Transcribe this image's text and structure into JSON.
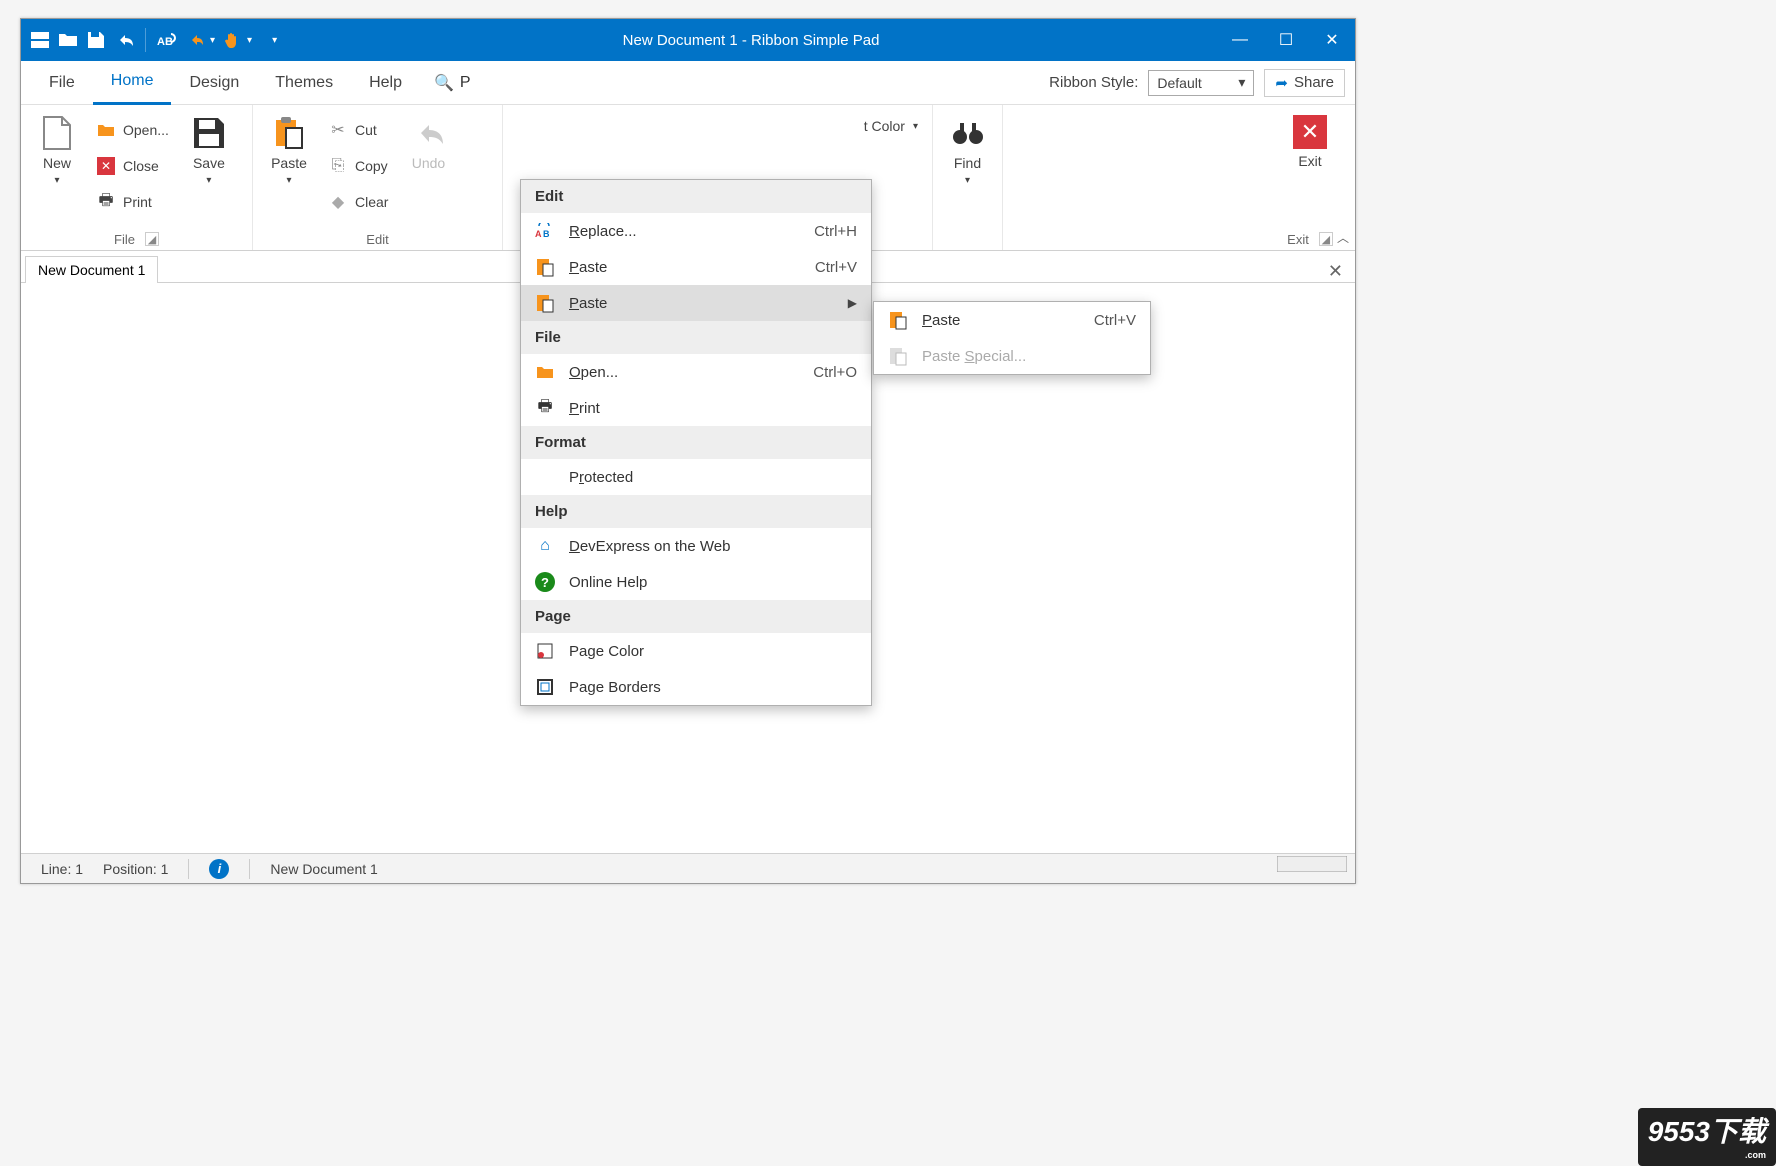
{
  "window": {
    "title": "New Document 1 - Ribbon Simple Pad"
  },
  "tabs": {
    "file": "File",
    "home": "Home",
    "design": "Design",
    "themes": "Themes",
    "help": "Help"
  },
  "search": "P",
  "ribbonStyle": {
    "label": "Ribbon Style:",
    "value": "Default"
  },
  "share": "Share",
  "ribbon": {
    "file": {
      "new": "New",
      "open": "Open...",
      "close": "Close",
      "print": "Print",
      "save": "Save",
      "groupLabel": "File"
    },
    "edit": {
      "paste": "Paste",
      "cut": "Cut",
      "copy": "Copy",
      "clear": "Clear",
      "undo": "Undo",
      "groupLabel": "Edit"
    },
    "format": {
      "fontColor": "t Color"
    },
    "find": "Find",
    "exit": "Exit",
    "exitGroup": "Exit"
  },
  "docTab": "New Document 1",
  "status": {
    "line": "Line: 1",
    "position": "Position: 1",
    "doc": "New Document 1"
  },
  "popup": {
    "sections": {
      "edit": "Edit",
      "file": "File",
      "format": "Format",
      "help": "Help",
      "page": "Page"
    },
    "replace": {
      "label": "Replace...",
      "shortcut": "Ctrl+H"
    },
    "paste1": {
      "label": "Paste",
      "shortcut": "Ctrl+V"
    },
    "paste2": {
      "label": "Paste"
    },
    "open": {
      "label": "Open...",
      "shortcut": "Ctrl+O"
    },
    "print": {
      "label": "Print"
    },
    "protected": "Protected",
    "devweb": "DevExpress on the Web",
    "onlinehelp": "Online Help",
    "pagecolor": "Page Color",
    "pageborders": "Page Borders"
  },
  "submenu": {
    "paste": {
      "label": "Paste",
      "shortcut": "Ctrl+V"
    },
    "pasteSpecial": "Paste Special..."
  },
  "badge": "9553下载"
}
